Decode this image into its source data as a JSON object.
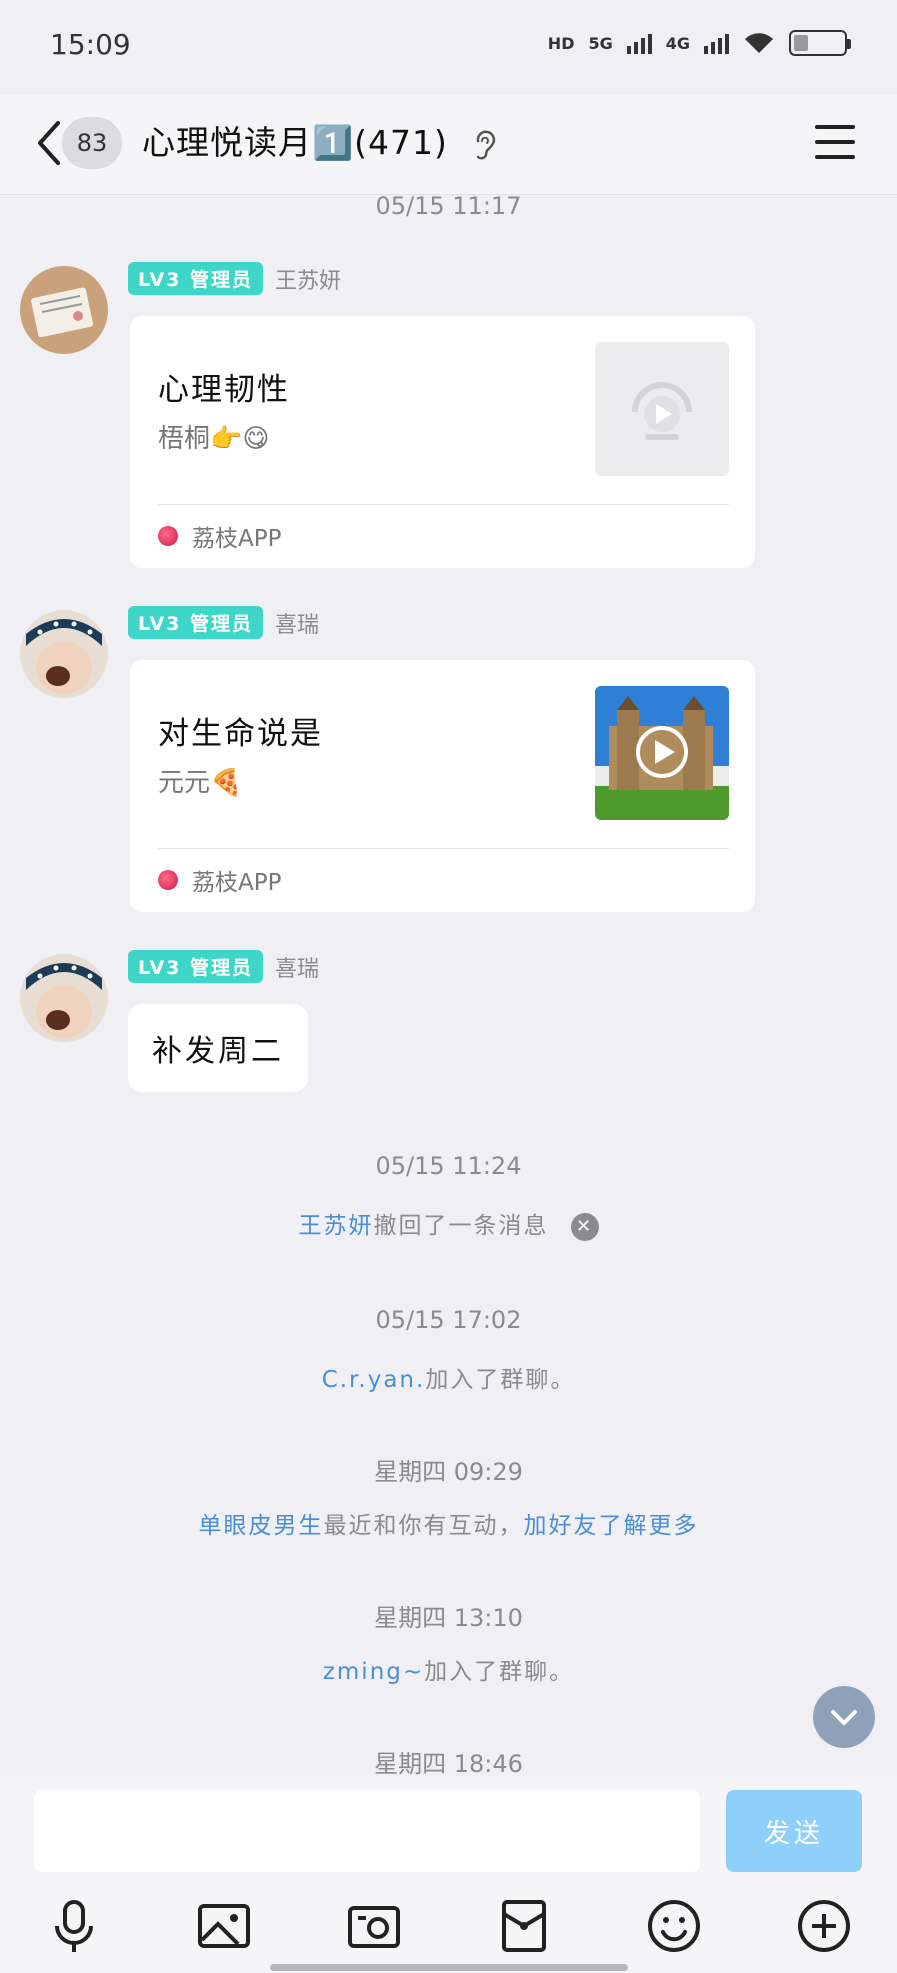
{
  "status_bar": {
    "time": "15:09",
    "hd_label": "HD",
    "net_5g": "5G",
    "net_4g": "4G"
  },
  "header": {
    "back_count": "83",
    "title": "心理悦读月1️⃣(471)",
    "icons": [
      "back-arrow-icon",
      "ear-icon",
      "menu-icon"
    ]
  },
  "messages": {
    "ts1": "05/15 11:17",
    "msg1": {
      "badge": "LV3 管理员",
      "sender": "王苏妍",
      "card_title": "心理韧性",
      "card_sub": "梧桐👉😋",
      "source": "荔枝APP"
    },
    "msg2": {
      "badge": "LV3 管理员",
      "sender": "喜瑞",
      "card_title": "对生命说是",
      "card_sub": "元元🍕",
      "source": "荔枝APP"
    },
    "msg3": {
      "badge": "LV3 管理员",
      "sender": "喜瑞",
      "text": "补发周二"
    },
    "ts2": "05/15 11:24",
    "recall": {
      "name": "王苏妍",
      "text": "撤回了一条消息"
    },
    "ts3": "05/15 17:02",
    "join1": {
      "name": "C.r.yan.",
      "text": "加入了群聊。"
    },
    "ts4": "星期四 09:29",
    "suggest": {
      "name": "单眼皮男生",
      "text": "最近和你有互动，",
      "action": "加好友了解更多"
    },
    "ts5": "星期四 13:10",
    "join2": {
      "name": "zming~",
      "text": "加入了群聊。"
    },
    "ts6": "星期四 18:46"
  },
  "composer": {
    "input_value": "",
    "send_label": "发送"
  },
  "toolbar": [
    "microphone-icon",
    "image-icon",
    "camera-icon",
    "red-packet-icon",
    "emoji-icon",
    "plus-icon"
  ],
  "colors": {
    "background": "#efeff4",
    "link": "#4a8fd6",
    "admin_badge": "#3dd6c9",
    "send_button": "#8fd0fa"
  }
}
